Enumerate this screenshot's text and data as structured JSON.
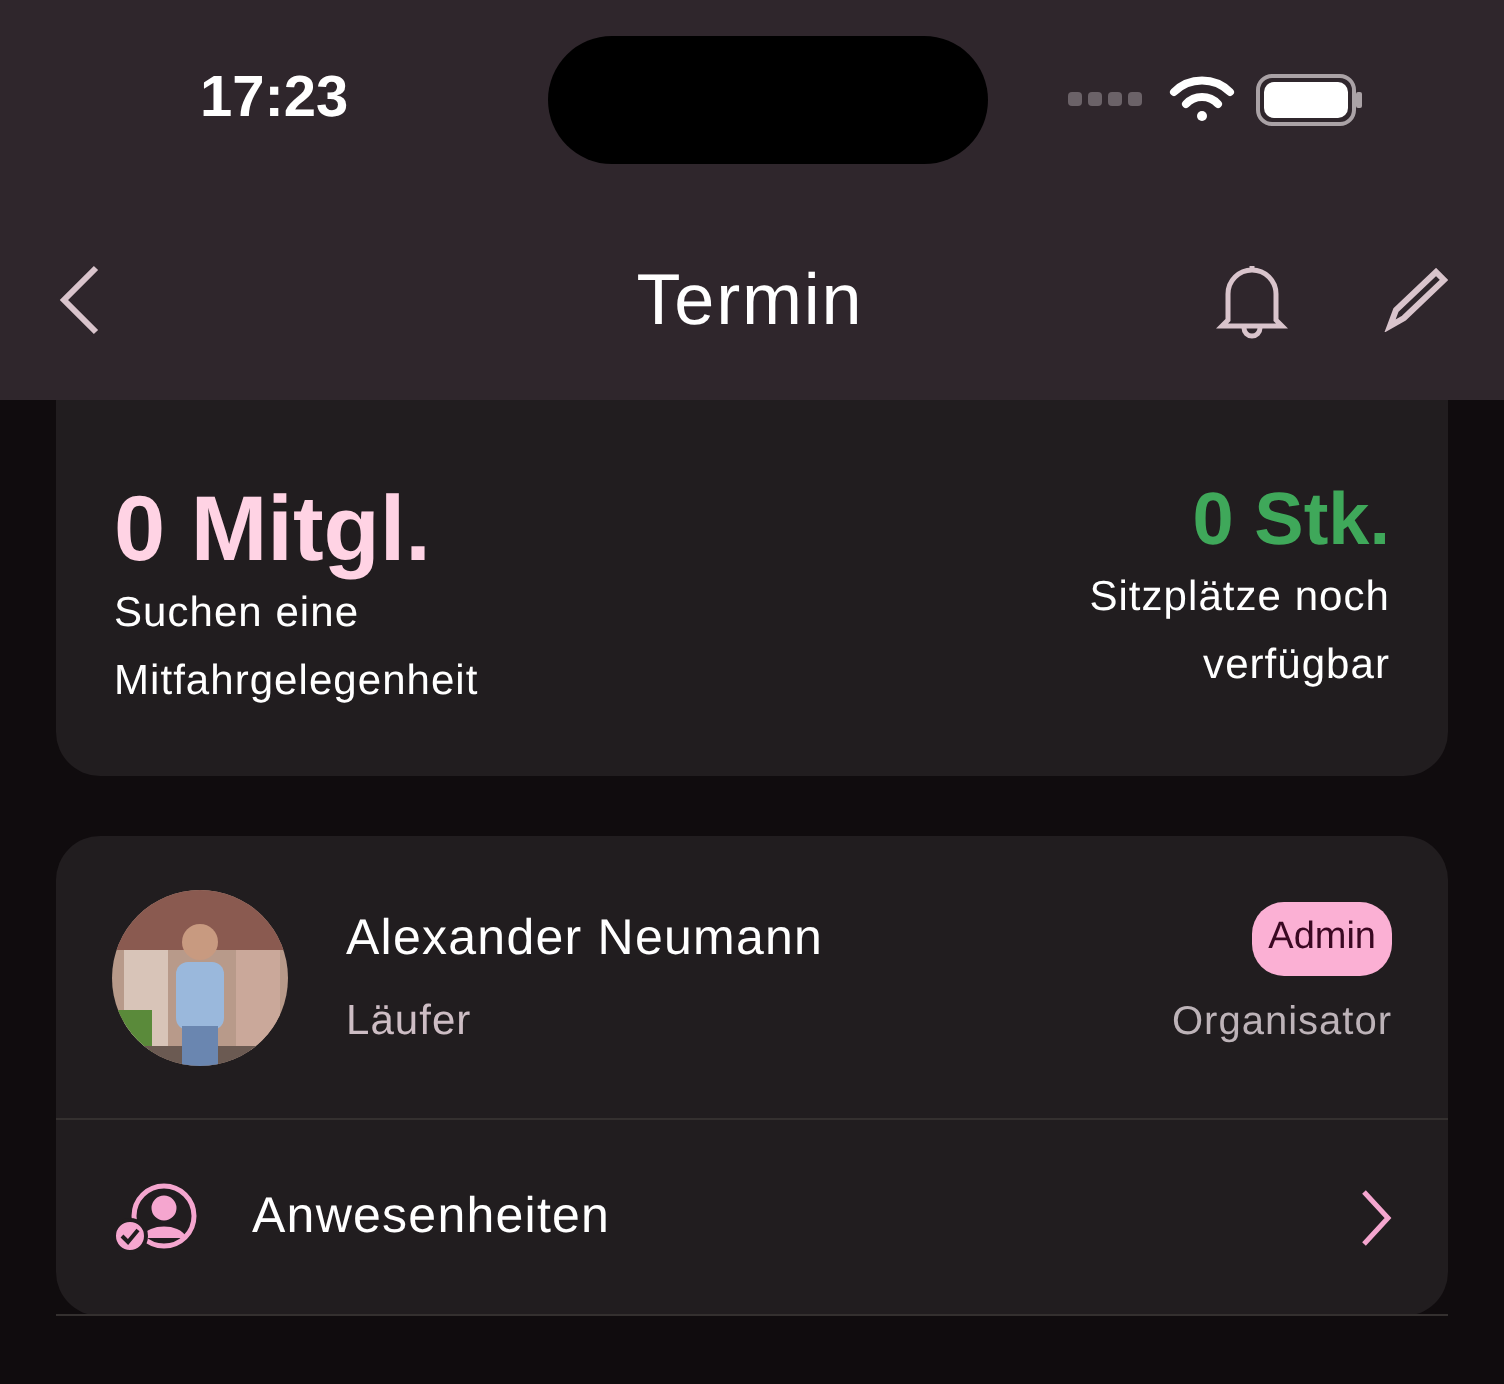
{
  "status_bar": {
    "time": "17:23"
  },
  "nav": {
    "title": "Termin"
  },
  "carpool_card": {
    "members": "0 Mitgl.",
    "members_caption": "Suchen eine Mitfahrgelegenheit",
    "seats": "0 Stk.",
    "seats_caption": "Sitzplätze noch verfügbar"
  },
  "organizer": {
    "name": "Alexander Neumann",
    "role": "Läufer",
    "badge": "Admin",
    "badge_caption": "Organisator"
  },
  "menu": [
    {
      "label": "Anwesenheiten"
    }
  ]
}
